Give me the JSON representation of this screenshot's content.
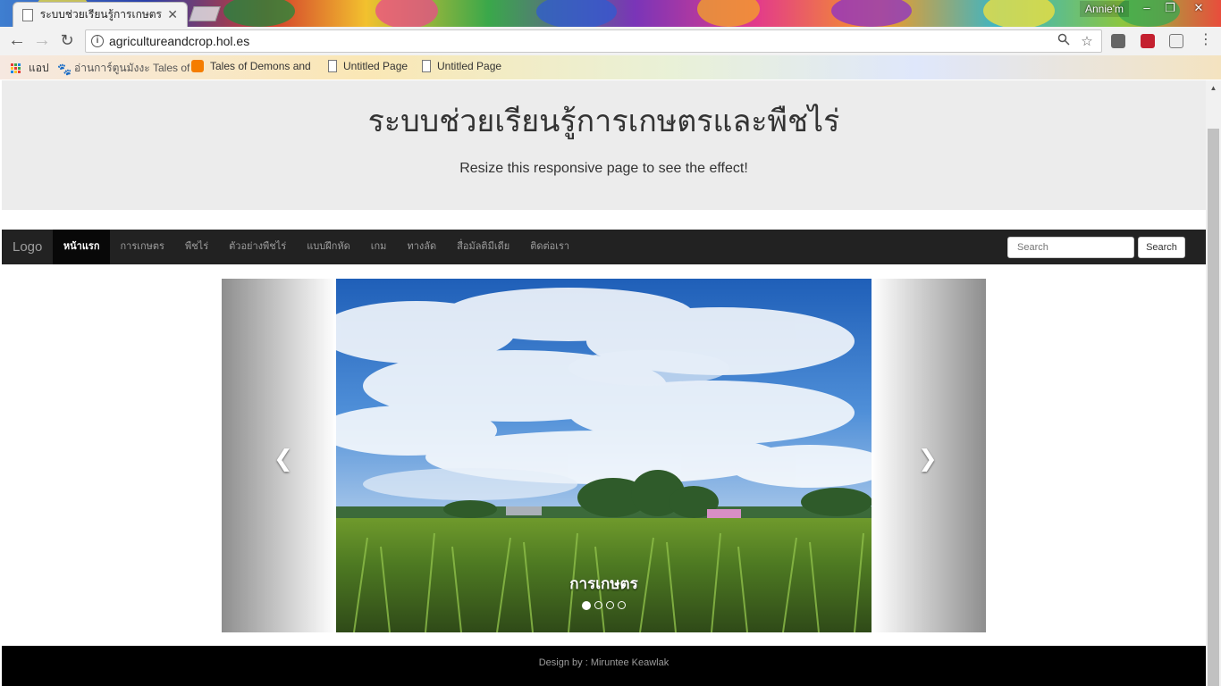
{
  "browser": {
    "tab_title": "ระบบช่วยเรียนรู้การเกษตรและพืชไร่",
    "profile_name": "Annie'm",
    "url": "agricultureandcrop.hol.es",
    "bookmarks": [
      {
        "label": "แอป",
        "icon": "apps-icon"
      },
      {
        "label": "อ่านการ์ตูนมังงะ Tales of",
        "icon": "paw-icon"
      },
      {
        "label": "Tales of Demons and",
        "icon": "blogger-icon"
      },
      {
        "label": "Untitled Page",
        "icon": "page-icon"
      },
      {
        "label": "Untitled Page",
        "icon": "page-icon"
      }
    ]
  },
  "header": {
    "title": "ระบบช่วยเรียนรู้การเกษตรและพืชไร่",
    "subtitle": "Resize this responsive page to see the effect!"
  },
  "navbar": {
    "brand": "Logo",
    "items": [
      "หน้าแรก",
      "การเกษตร",
      "พืชไร่",
      "ตัวอย่างพืชไร่",
      "แบบฝึกหัด",
      "เกม",
      "ทางลัด",
      "สื่อมัลติมีเดีย",
      "ติดต่อเรา"
    ],
    "active_index": 0,
    "search_placeholder": "Search",
    "search_button": "Search"
  },
  "carousel": {
    "caption": "การเกษตร",
    "slide_count": 4,
    "active_slide": 0
  },
  "footer": {
    "text": "Design by : Miruntee Keawlak"
  }
}
